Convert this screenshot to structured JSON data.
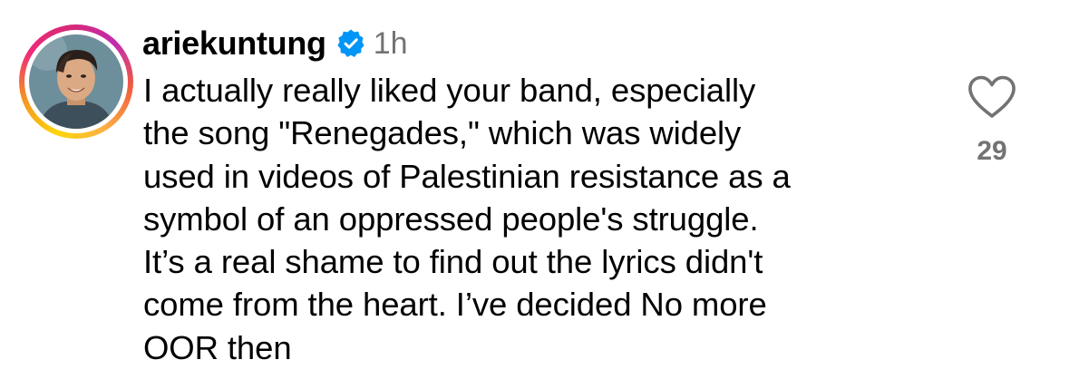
{
  "comment": {
    "username": "ariekuntung",
    "verified": true,
    "timestamp": "1h",
    "text": "I actually really liked your band, especially\nthe song \"Renegades,\" which was widely\nused in videos of Palestinian resistance as a\nsymbol of an oppressed people's struggle.\nIt’s a real shame to find out the lyrics didn't\ncome from the heart. I’ve decided No more\nOOR then",
    "like_count": "29",
    "like_icon": "heart-outline-icon",
    "verified_icon": "verified-badge-icon"
  },
  "colors": {
    "verified_badge": "#0095f6",
    "secondary_text": "#737373",
    "primary_text": "#000000"
  }
}
